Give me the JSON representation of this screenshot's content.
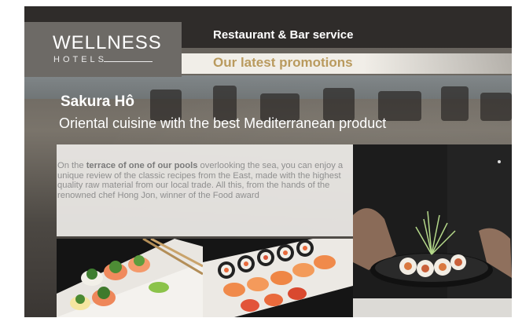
{
  "header": {
    "brand_main": "WELLNESS",
    "brand_sub": "HOTELS",
    "service": "Restaurant & Bar service",
    "promotions": "Our latest promotions"
  },
  "feature": {
    "title": "Sakura Hô",
    "subtitle": "Oriental cuisine with the best Mediterranean product",
    "desc_1": "On the ",
    "desc_bold_1": "terrace of one of our pools",
    "desc_2": " overlooking the sea, you can enjoy a unique review of the classic recipes from the East, made with the highest quality raw material from our local trade. All this, from the hands of the renowned chef Hong Jon, winner of the Food award"
  },
  "colors": {
    "accent_gold": "#b99a5e",
    "logo_box": "#6d6a66",
    "top_bar": "#2f2c2a"
  },
  "images": [
    "sushi-plate-photo",
    "sushi-platter-photo",
    "chef-plating-photo"
  ]
}
